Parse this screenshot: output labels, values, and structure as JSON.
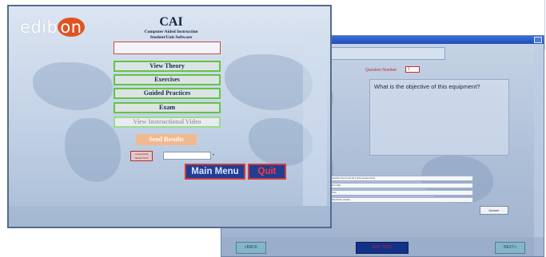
{
  "colors": {
    "accent_green": "#63c444",
    "accent_red": "#d23a3a",
    "button_navy": "#1f3e94",
    "logo_orange": "#e2531f",
    "send_orange": "#f1b990"
  },
  "front_window": {
    "logo_prefix": "edib",
    "logo_on": "on",
    "title": "CAI",
    "subtitle1": "Computer Aided Instruction",
    "subtitle2": "Student/Unit Software",
    "menu": [
      {
        "label": "View Theory"
      },
      {
        "label": "Exercises"
      },
      {
        "label": "Guided Practices"
      },
      {
        "label": "Exam"
      },
      {
        "label": "View Instructional Video"
      }
    ],
    "send_results": "Send Results",
    "language_label": "LANGUAGE SELECTION",
    "main_menu": "Main Menu",
    "quit": "Quit"
  },
  "back_window": {
    "question_number_label": "Question Number",
    "question_number_value": "1",
    "question_text": "What is the objective of this equipment?",
    "answers": [
      "Justifies them and fix it with section blow",
      "Not offer",
      "Test",
      "Electrical module"
    ],
    "answer_button": "Answer",
    "back_button": "<BACK",
    "exit_button": "EXIT TEST",
    "next_button": "NEXT>"
  }
}
